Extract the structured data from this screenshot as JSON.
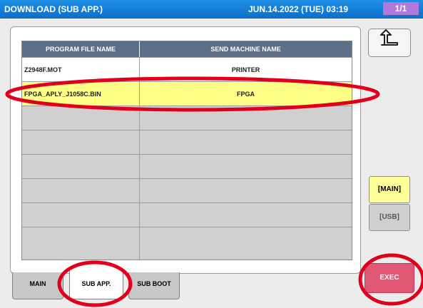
{
  "header": {
    "title": "DOWNLOAD (SUB APP.)",
    "datetime": "JUN.14.2022 (TUE) 03:19",
    "page": "1/1"
  },
  "table": {
    "columns": [
      "PROGRAM FILE NAME",
      "SEND MACHINE NAME"
    ],
    "rows": [
      {
        "program": "Z2948F.MOT",
        "machine": "PRINTER"
      },
      {
        "program": "FPGA_APLY_J1058C.BIN",
        "machine": "FPGA"
      },
      {
        "program": "",
        "machine": ""
      },
      {
        "program": "",
        "machine": ""
      },
      {
        "program": "",
        "machine": ""
      },
      {
        "program": "",
        "machine": ""
      },
      {
        "program": "",
        "machine": ""
      },
      {
        "program": "",
        "machine": ""
      }
    ],
    "selected_index": 1
  },
  "side": {
    "up_icon": "return-arrow-icon",
    "main_label": "[MAIN]",
    "usb_label": "[USB]"
  },
  "tabs": [
    {
      "label": "MAIN",
      "active": false
    },
    {
      "label": "SUB APP.",
      "active": true
    },
    {
      "label": "SUB BOOT",
      "active": false
    }
  ],
  "exec_label": "EXEC",
  "colors": {
    "titlebar": "#0a6fc8",
    "page_indicator": "#b07ad8",
    "header_row": "#5d6f86",
    "selected_row": "#ffff88",
    "main_button": "#ffff99",
    "exec_button": "#e05876",
    "annotation": "#e0001b"
  }
}
